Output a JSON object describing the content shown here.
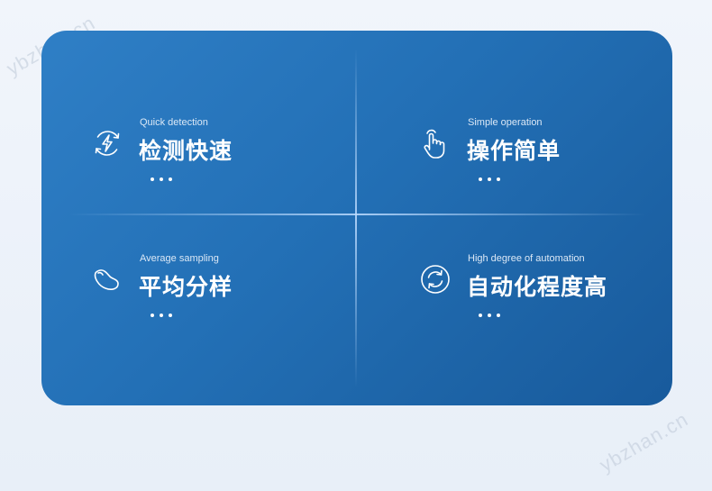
{
  "watermark": "ybzhan.cn",
  "features": [
    {
      "subtitle": "Quick detection",
      "title": "检测快速",
      "icon": "lightning-cycle-icon"
    },
    {
      "subtitle": "Simple operation",
      "title": "操作简单",
      "icon": "pointing-hand-icon"
    },
    {
      "subtitle": "Average sampling",
      "title": "平均分样",
      "icon": "grain-icon"
    },
    {
      "subtitle": "High degree of automation",
      "title": "自动化程度高",
      "icon": "refresh-cycle-icon"
    }
  ],
  "colors": {
    "card_start": "#2f7fc6",
    "card_end": "#185a9c",
    "text": "#ffffff"
  }
}
